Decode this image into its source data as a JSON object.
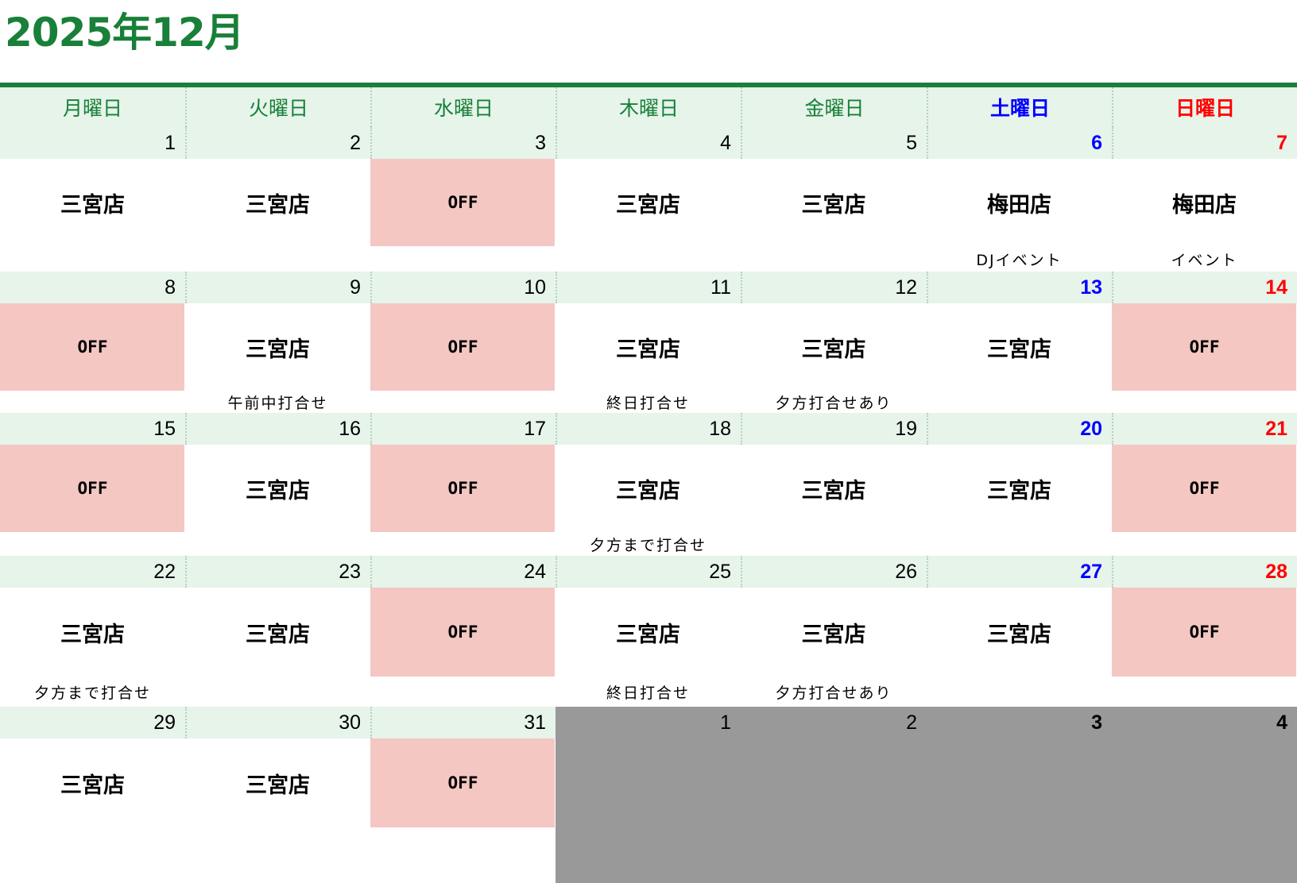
{
  "title": "2025年12月",
  "colors": {
    "accent": "#188038",
    "header_bg": "#e6f4ea",
    "off_bg": "#f4c7c3",
    "saturday": "#0000ff",
    "sunday": "#ff0000",
    "next_month_bg": "#999999"
  },
  "weekdays": [
    "月曜日",
    "火曜日",
    "水曜日",
    "木曜日",
    "金曜日",
    "土曜日",
    "日曜日"
  ],
  "weeks": [
    [
      {
        "date": "1",
        "venue": "三宮店",
        "note": ""
      },
      {
        "date": "2",
        "venue": "三宮店",
        "note": ""
      },
      {
        "date": "3",
        "venue": "OFF",
        "note": ""
      },
      {
        "date": "4",
        "venue": "三宮店",
        "note": ""
      },
      {
        "date": "5",
        "venue": "三宮店",
        "note": ""
      },
      {
        "date": "6",
        "venue": "梅田店",
        "note": "DJイベント"
      },
      {
        "date": "7",
        "venue": "梅田店",
        "note": "イベント"
      }
    ],
    [
      {
        "date": "8",
        "venue": "OFF",
        "note": ""
      },
      {
        "date": "9",
        "venue": "三宮店",
        "note": "午前中打合せ"
      },
      {
        "date": "10",
        "venue": "OFF",
        "note": ""
      },
      {
        "date": "11",
        "venue": "三宮店",
        "note": "終日打合せ"
      },
      {
        "date": "12",
        "venue": "三宮店",
        "note": "夕方打合せあり"
      },
      {
        "date": "13",
        "venue": "三宮店",
        "note": ""
      },
      {
        "date": "14",
        "venue": "OFF",
        "note": ""
      }
    ],
    [
      {
        "date": "15",
        "venue": "OFF",
        "note": ""
      },
      {
        "date": "16",
        "venue": "三宮店",
        "note": ""
      },
      {
        "date": "17",
        "venue": "OFF",
        "note": ""
      },
      {
        "date": "18",
        "venue": "三宮店",
        "note": "夕方まで打合せ"
      },
      {
        "date": "19",
        "venue": "三宮店",
        "note": ""
      },
      {
        "date": "20",
        "venue": "三宮店",
        "note": ""
      },
      {
        "date": "21",
        "venue": "OFF",
        "note": ""
      }
    ],
    [
      {
        "date": "22",
        "venue": "三宮店",
        "note": "夕方まで打合せ"
      },
      {
        "date": "23",
        "venue": "三宮店",
        "note": ""
      },
      {
        "date": "24",
        "venue": "OFF",
        "note": ""
      },
      {
        "date": "25",
        "venue": "三宮店",
        "note": "終日打合せ"
      },
      {
        "date": "26",
        "venue": "三宮店",
        "note": "夕方打合せあり"
      },
      {
        "date": "27",
        "venue": "三宮店",
        "note": ""
      },
      {
        "date": "28",
        "venue": "OFF",
        "note": ""
      }
    ],
    [
      {
        "date": "29",
        "venue": "三宮店",
        "note": ""
      },
      {
        "date": "30",
        "venue": "三宮店",
        "note": ""
      },
      {
        "date": "31",
        "venue": "OFF",
        "note": ""
      },
      {
        "date": "1",
        "venue": "",
        "note": "",
        "next_month": true
      },
      {
        "date": "2",
        "venue": "",
        "note": "",
        "next_month": true
      },
      {
        "date": "3",
        "venue": "",
        "note": "",
        "next_month": true
      },
      {
        "date": "4",
        "venue": "",
        "note": "",
        "next_month": true
      }
    ]
  ]
}
